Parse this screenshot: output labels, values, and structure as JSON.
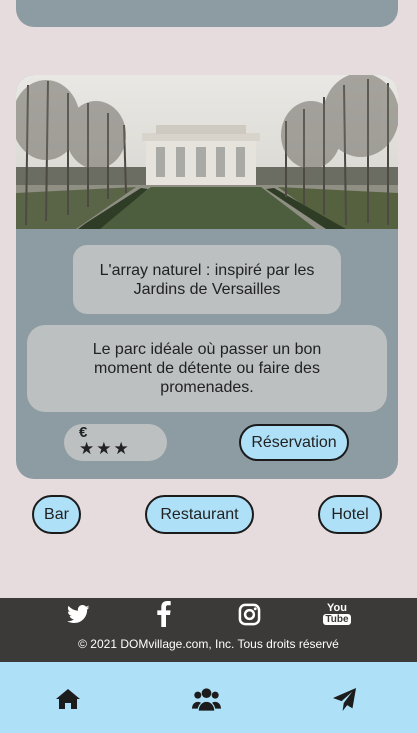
{
  "card": {
    "title": "L'array naturel : inspiré par les Jardins de Versailles",
    "description": "Le parc idéale où passer un bon moment de détente ou faire des promenades.",
    "price_currency": "€",
    "price_stars": "★★★",
    "reserve_label": "Réservation"
  },
  "categories": [
    {
      "label": "Bar"
    },
    {
      "label": "Restaurant"
    },
    {
      "label": "Hotel"
    }
  ],
  "footer": {
    "social": [
      "twitter-icon",
      "facebook-icon",
      "instagram-icon",
      "youtube-icon"
    ],
    "youtube_you": "You",
    "youtube_tube": "Tube",
    "copyright": "© 2021 DOMvillage.com, Inc. Tous droits réservé"
  },
  "navbar": {
    "items": [
      "home-icon",
      "users-icon",
      "send-icon"
    ]
  },
  "colors": {
    "background": "#e7dcdd",
    "card": "#8d9ba2",
    "text_box": "#bcc0c1",
    "accent": "#aee0f8",
    "footer": "#3b3a38"
  }
}
